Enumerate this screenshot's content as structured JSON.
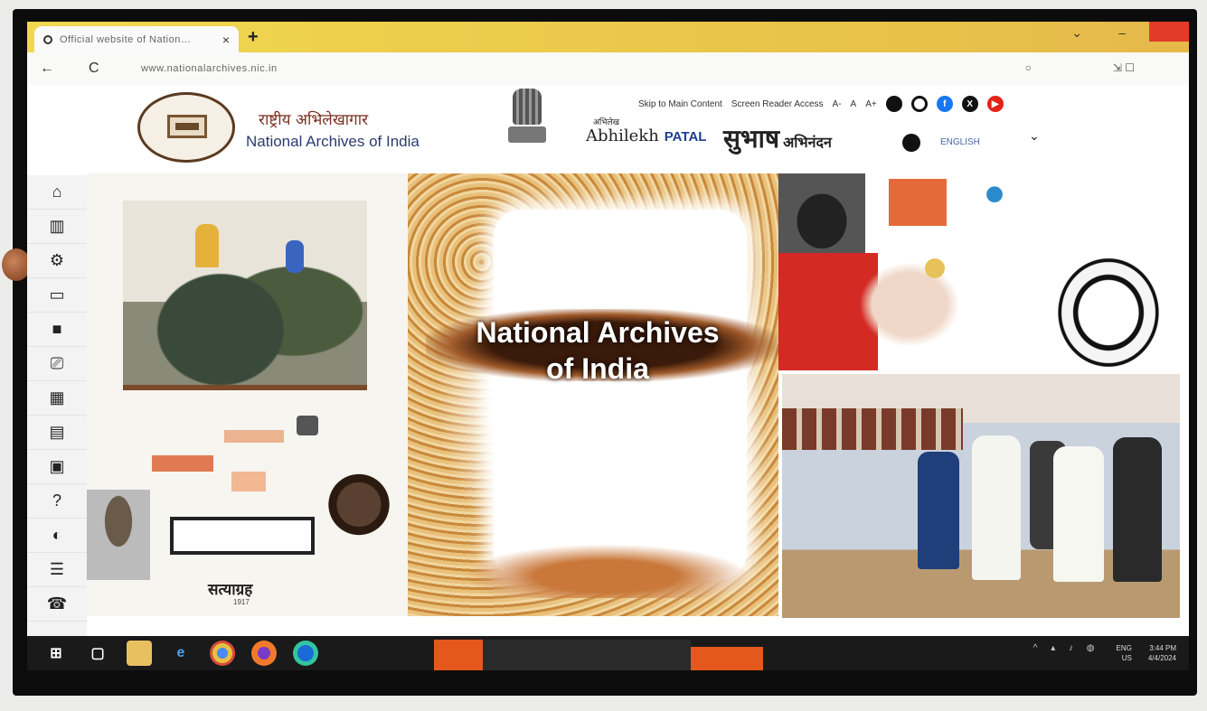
{
  "browser": {
    "tab_title": "Official website of Nation…",
    "tab_close": "×",
    "new_tab": "+",
    "url": "www.nationalarchives.nic.in",
    "back": "←",
    "reload": "C"
  },
  "header": {
    "name_hindi": "राष्ट्रीय अभिलेखागार",
    "name_english": "National Archives of India",
    "portal_top": "अभिलेख",
    "portal_brand": "Abhilekh",
    "portal_suffix": "PATAL",
    "subhash_main": "सुभाष",
    "subhash_sub": "अभिनंदन",
    "skip_link": "Skip to Main Content",
    "screen_reader": "Screen Reader Access",
    "font_sizes": [
      "A-",
      "A",
      "A+"
    ],
    "language": "ENGLISH",
    "social": [
      "facebook-icon",
      "x-icon",
      "youtube-icon"
    ]
  },
  "sidebar": {
    "items": [
      "home-icon",
      "museum-icon",
      "settings-person-icon",
      "id-card-icon",
      "record-icon",
      "research-icon",
      "calendar-icon",
      "document-search-icon",
      "gallery-icon",
      "faq-icon",
      "feedback-icon",
      "form-icon",
      "phone-icon"
    ]
  },
  "hero": {
    "title_line1": "National Archives",
    "title_line2": "of India",
    "satyagraha_text": "सत्याग्रह",
    "satyagraha_year": "1917"
  },
  "taskbar": {
    "apps": [
      "windows-icon",
      "task-view-icon",
      "file-explorer-icon",
      "edge-legacy-icon",
      "chrome-icon",
      "firefox-icon",
      "edge-icon"
    ],
    "lang": "ENG",
    "region": "US",
    "time": "3:44 PM",
    "date": "4/4/2024"
  },
  "colors": {
    "tab_strip": "#f2d84e",
    "site_blue": "#2b3d6e",
    "site_maroon": "#7a3020",
    "facebook": "#1877f2",
    "x": "#111111",
    "youtube": "#e62117"
  }
}
